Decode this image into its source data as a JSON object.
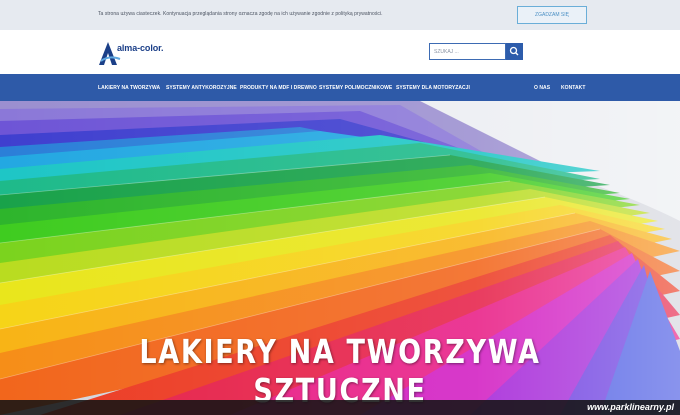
{
  "cookie_bar": {
    "text": "Ta strona używa ciasteczek. Kontynuacja przeglądania strony oznacza zgodę na ich używanie zgodnie z polityką prywatności.",
    "accept_label": "ZGADZAM SIĘ"
  },
  "header": {
    "logo_text": "alma-color.",
    "search_placeholder": "SZUKAJ ...",
    "flags": [
      "polish-flag",
      "slovak-flag"
    ]
  },
  "nav": {
    "items_left": [
      "LAKIERY NA TWORZYWA",
      "SYSTEMY ANTYKOROZYJNE",
      "PRODUKTY NA MDF I DREWNO",
      "SYSTEMY POLIMOCZNIKOWE",
      "SYSTEMY DLA MOTORYZACJI"
    ],
    "items_right": [
      "O NAS",
      "KONTAKT"
    ]
  },
  "hero": {
    "title": "LAKIERY NA TWORZYWA SZTUCZNE"
  },
  "watermark": "www.parklinearny.pl",
  "colors": {
    "brand_blue": "#2e5aa8",
    "cookie_bg": "#e6eaf0"
  }
}
